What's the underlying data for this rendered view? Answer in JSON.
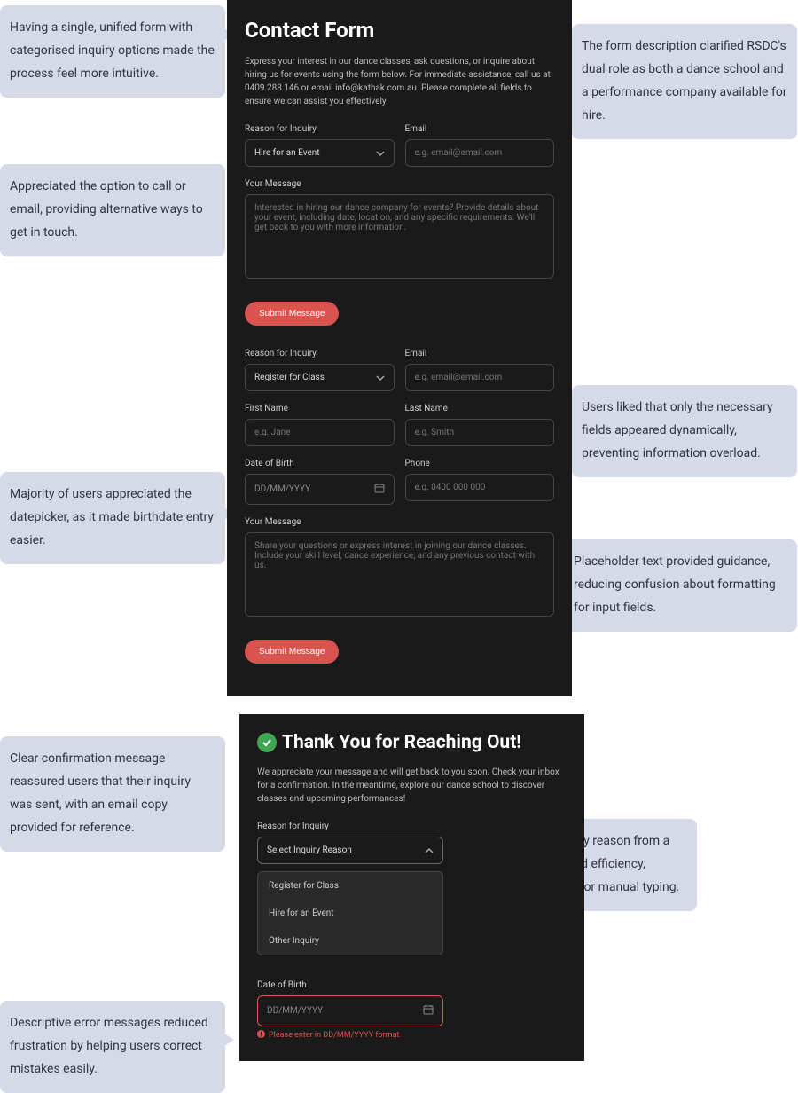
{
  "callouts": {
    "c1": "Having a single, unified form with categorised inquiry options made the process feel more intuitive.",
    "c2": "Appreciated the option to call or email, providing alternative ways to get in touch.",
    "c3": "Majority of users appreciated the datepicker, as it made birthdate entry easier.",
    "c4": "Clear confirmation message reassured users that their inquiry was sent, with an email copy provided for reference.",
    "c5": "Descriptive error messages reduced frustration by helping users correct mistakes easily.",
    "c6": "The form description clarified RSDC's dual role as both a dance school and a performance company available for hire.",
    "c7": "Users liked that only the necessary fields appeared dynamically, preventing information overload.",
    "c8": "Placeholder text provided guidance, reducing confusion about formatting for input fields.",
    "c9": "Selecting the inquiry reason from a dropdown improved efficiency, reducing the need for manual typing."
  },
  "form1": {
    "title": "Contact Form",
    "desc": "Express your interest in our dance classes, ask questions, or inquire about hiring us for events using the form below. For immediate assistance, call us at 0409 288 146 or email info@kathak.com.au. Please complete all fields to ensure we can assist you effectively.",
    "reason_label": "Reason for Inquiry",
    "reason_value": "Hire for an Event",
    "email_label": "Email",
    "email_placeholder": "e.g. email@email.com",
    "message_label": "Your Message",
    "message_placeholder": "Interested in hiring our dance company for events? Provide details about your event, including date, location, and any specific requirements. We'll get back to you with more information.",
    "submit": "Submit Message"
  },
  "form2": {
    "reason_label": "Reason for Inquiry",
    "reason_value": "Register for Class",
    "email_label": "Email",
    "email_placeholder": "e.g. email@email.com",
    "firstname_label": "First Name",
    "firstname_placeholder": "e.g. Jane",
    "lastname_label": "Last Name",
    "lastname_placeholder": "e.g. Smith",
    "dob_label": "Date of Birth",
    "dob_placeholder": "DD/MM/YYYY",
    "phone_label": "Phone",
    "phone_placeholder": "e.g. 0400 000 000",
    "message_label": "Your Message",
    "message_placeholder": "Share your questions or express interest in joining our dance classes. Include your skill level, dance experience, and any previous contact with us.",
    "submit": "Submit Message"
  },
  "thankyou": {
    "title": "Thank You for Reaching Out!",
    "desc": "We appreciate your message and will get back to you soon. Check your inbox for a confirmation. In the meantime, explore our dance school to discover classes and upcoming performances!",
    "reason_label": "Reason for Inquiry",
    "reason_value": "Select Inquiry Reason",
    "options": {
      "opt1": "Register for Class",
      "opt2": "Hire for an Event",
      "opt3": "Other Inquiry"
    },
    "dob_label": "Date of Birth",
    "dob_placeholder": "DD/MM/YYYY",
    "error": "Please enter in DD/MM/YYYY format"
  }
}
